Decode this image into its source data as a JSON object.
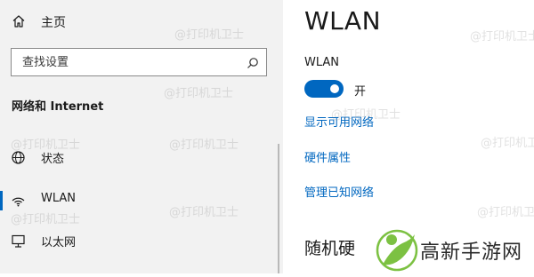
{
  "sidebar": {
    "home_label": "主页",
    "search": {
      "placeholder": "查找设置",
      "value": ""
    },
    "section_title": "网络和 Internet",
    "items": [
      {
        "label": "状态",
        "icon": "globe-icon"
      },
      {
        "label": "WLAN",
        "icon": "wifi-icon",
        "active": true
      },
      {
        "label": "以太网",
        "icon": "ethernet-icon"
      }
    ]
  },
  "main": {
    "title": "WLAN",
    "wlan_label": "WLAN",
    "toggle": {
      "state": "on",
      "label": "开"
    },
    "links": {
      "available_networks": "显示可用网络",
      "hardware_properties": "硬件属性",
      "manage_known": "管理已知网络"
    },
    "random_title": "随机硬"
  },
  "watermark": {
    "text": "@打印机卫士"
  },
  "brand": {
    "text": "高新手游网"
  },
  "colors": {
    "accent": "#0067c0",
    "sidebar_bg": "#f2f2f2",
    "logo_green": "#7cc142"
  }
}
